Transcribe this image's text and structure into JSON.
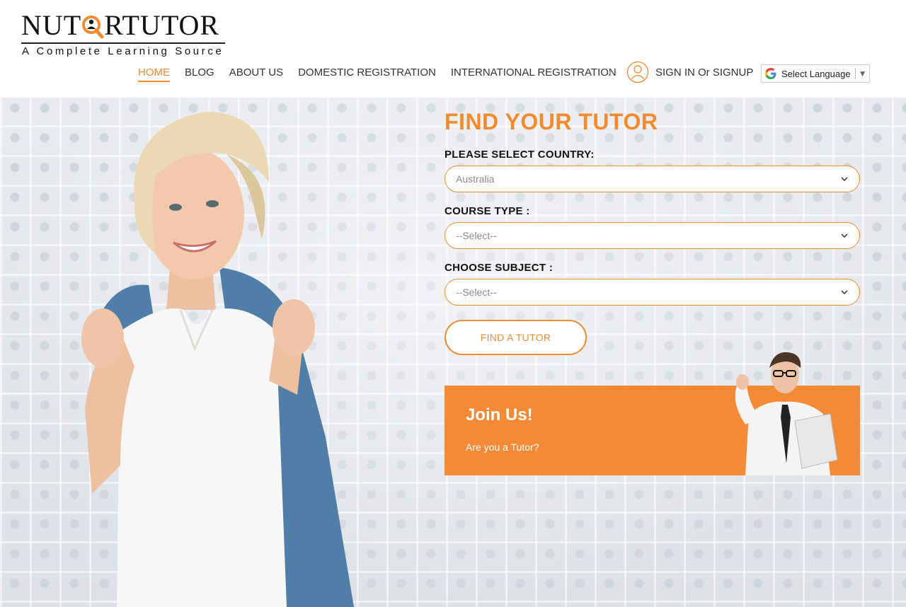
{
  "brand": {
    "logo_text_left": "NUT",
    "logo_text_right": "RTUTOR",
    "tagline": "A Complete Learning Source"
  },
  "nav": {
    "items": [
      "HOME",
      "BLOG",
      "ABOUT US",
      "DOMESTIC REGISTRATION",
      "INTERNATIONAL REGISTRATION"
    ],
    "active": "HOME",
    "separator": "/",
    "signin": "SIGN IN Or SIGNUP"
  },
  "language": {
    "label": "Select Language",
    "arrow": "▼"
  },
  "form": {
    "title": "FIND YOUR TUTOR",
    "country_label": "PLEASE SELECT COUNTRY:",
    "country_value": "Australia",
    "course_label": "COURSE TYPE :",
    "course_value": "--Select--",
    "subject_label": "CHOOSE SUBJECT :",
    "subject_value": "--Select--",
    "button": "FIND A TUTOR"
  },
  "join": {
    "title": "Join Us!",
    "subtitle": "Are you a Tutor?"
  },
  "colors": {
    "accent": "#f28a30",
    "join_bg": "#f48a35"
  },
  "icons": {
    "user": "user-icon",
    "google": "google-icon",
    "chevron": "chevron-down-icon",
    "search": "magnifier-icon"
  }
}
